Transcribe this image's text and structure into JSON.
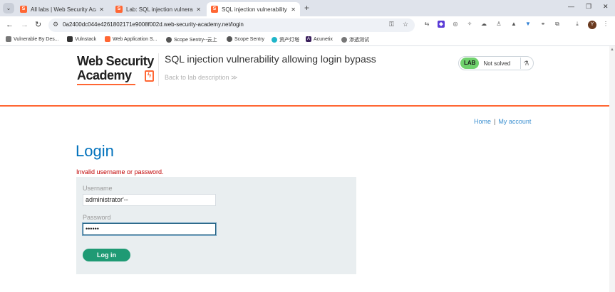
{
  "browser": {
    "tabs": [
      {
        "title": "All labs | Web Security Acade",
        "active": false
      },
      {
        "title": "Lab: SQL injection vulnerabili",
        "active": false
      },
      {
        "title": "SQL injection vulnerability al",
        "active": true
      }
    ],
    "favicon_letter": "S",
    "url": "0a2400dc044e4261802171e9008f002d.web-security-academy.net/login",
    "avatar_letter": "Y",
    "bookmarks": [
      {
        "label": "Vulnerable By Des..."
      },
      {
        "label": "Vulnstack"
      },
      {
        "label": "Web Application S..."
      },
      {
        "label": "Scope Sentry--云上"
      },
      {
        "label": "Scope Sentry"
      },
      {
        "label": "资产灯塔"
      },
      {
        "label": "Acunetix"
      },
      {
        "label": "渗透测试"
      }
    ],
    "accent": "#ff6633"
  },
  "header": {
    "logo_line1": "Web Security",
    "logo_line2": "Academy",
    "lab_title": "SQL injection vulnerability allowing login bypass",
    "back_link": "Back to lab description ≫",
    "status_tag": "LAB",
    "status_text": "Not solved"
  },
  "nav": {
    "home": "Home",
    "separator": "|",
    "account": "My account"
  },
  "login": {
    "heading": "Login",
    "error": "Invalid username or password.",
    "username_label": "Username",
    "username_value": "administrator'--",
    "password_label": "Password",
    "password_value": "••••••",
    "submit": "Log in"
  }
}
